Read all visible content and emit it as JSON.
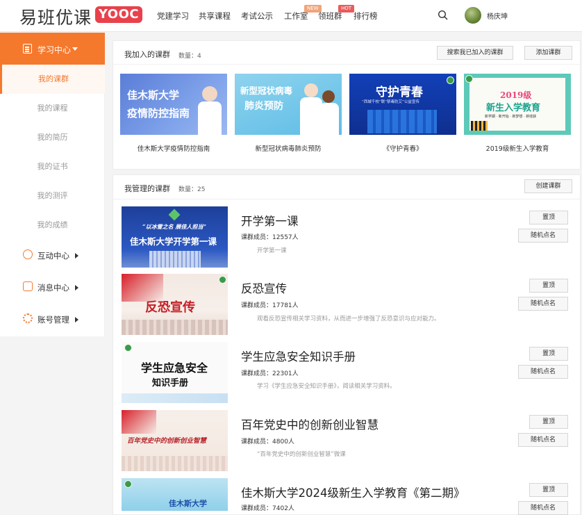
{
  "brand": {
    "name": "易班优课",
    "badge": "YOOC",
    "badge_color": "#e8414b"
  },
  "nav": [
    {
      "label": "党建学习"
    },
    {
      "label": "共享课程"
    },
    {
      "label": "考试公示"
    },
    {
      "label": "工作室",
      "tag": "NEW"
    },
    {
      "label": "领班群",
      "tag": "HOT"
    },
    {
      "label": "排行榜"
    }
  ],
  "user": {
    "name": "杨庆坤"
  },
  "sidebar": {
    "accent": "#f5792d",
    "head": "学习中心",
    "subs": [
      "我的课群",
      "我的课程",
      "我的简历",
      "我的证书",
      "我的测评",
      "我的成绩"
    ],
    "groups": [
      "互动中心",
      "消息中心",
      "账号管理"
    ]
  },
  "joined": {
    "title": "我加入的课群",
    "count_label": "数量：",
    "count": "4",
    "search_btn": "搜索我已加入的课群",
    "add_btn": "添加课群",
    "cards": [
      {
        "caption": "佳木斯大学疫情防控指南",
        "cover_line1": "佳木斯大学",
        "cover_line2": "疫情防控指南"
      },
      {
        "caption": "新型冠状病毒肺炎预防",
        "cover_line1": "新型冠状病毒",
        "cover_line2": "肺炎预防"
      },
      {
        "caption": "《守护青春》",
        "cover_line1": "守护青春",
        "cover_line2": "“西城千校”联“禁毒防艾”公益宣传"
      },
      {
        "caption": "2019级新生入学教育",
        "cover_line1": "2019级",
        "cover_line2": "新生入学教育",
        "cover_line3": "新学期 · 新开始 · 新梦想 · 新收获"
      }
    ]
  },
  "managed": {
    "title": "我管理的课群",
    "count_label": "数量：",
    "count": "25",
    "create_btn": "创建课群",
    "top_btn": "置顶",
    "rollcall_btn": "随机点名",
    "members_label": "课群成员：",
    "rows": [
      {
        "title": "开学第一课",
        "members": "12557人",
        "desc": "开学第一课",
        "cover_line1": "“以冰雪之名 展佳人担当”",
        "cover_line2": "佳木斯大学开学第一课"
      },
      {
        "title": "反恐宣传",
        "members": "17781人",
        "desc": "观看反恐宣传相关学习资料，从而进一步增强了反恐意识与应对能力。",
        "cover_line1": "反恐宣传"
      },
      {
        "title": "学生应急安全知识手册",
        "members": "22301人",
        "desc": "学习《学生应急安全知识手册》，阅读相关学习资料。",
        "cover_line1": "学生应急安全",
        "cover_line2": "知识手册"
      },
      {
        "title": "百年党史中的创新创业智慧",
        "members": "4800人",
        "desc": "“百年党史中的创新创业智慧”微课",
        "cover_line1": "百年党史中的创新创业智慧"
      },
      {
        "title": "佳木斯大学2024级新生入学教育《第二期》",
        "members": "7402人",
        "desc": "",
        "cover_line1": "佳木斯大学"
      }
    ]
  }
}
